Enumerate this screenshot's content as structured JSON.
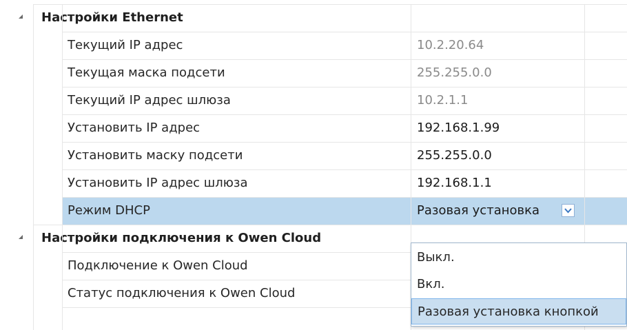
{
  "categories": [
    {
      "title": "Настройки Ethernet",
      "properties": [
        {
          "name": "Текущий IP адрес",
          "value": "10.2.20.64",
          "style": "grey"
        },
        {
          "name": "Текущая маска подсети",
          "value": "255.255.0.0",
          "style": "grey"
        },
        {
          "name": "Текущий IP адрес шлюза",
          "value": "10.2.1.1",
          "style": "grey"
        },
        {
          "name": "Установить IP адрес",
          "value": "192.168.1.99",
          "style": "dark"
        },
        {
          "name": "Установить маску подсети",
          "value": "255.255.0.0",
          "style": "dark"
        },
        {
          "name": "Установить IP адрес шлюза",
          "value": "192.168.1.1",
          "style": "dark"
        },
        {
          "name": "Режим DHCP",
          "value": "Разовая установка",
          "style": "dark",
          "selected": true,
          "combo": true
        }
      ]
    },
    {
      "title": "Настройки подключения к Owen Cloud",
      "properties": [
        {
          "name": "Подключение к Owen Cloud",
          "value": "",
          "style": "dark"
        },
        {
          "name": "Статус подключения к Owen Cloud",
          "value": "",
          "style": "dark"
        }
      ]
    }
  ],
  "dropdown": {
    "options": [
      "Выкл.",
      "Вкл.",
      "Разовая установка кнопкой"
    ],
    "hovered_index": 2
  },
  "icons": {
    "expander": "expander-triangle-icon",
    "combo": "chevron-down-icon"
  },
  "colors": {
    "selected_row": "#bcd8ee",
    "grid_line": "#e6e6e6",
    "readonly_value": "#8a8a8a",
    "editable_value": "#1a1a1a",
    "dropdown_hover": "#c9def0"
  }
}
